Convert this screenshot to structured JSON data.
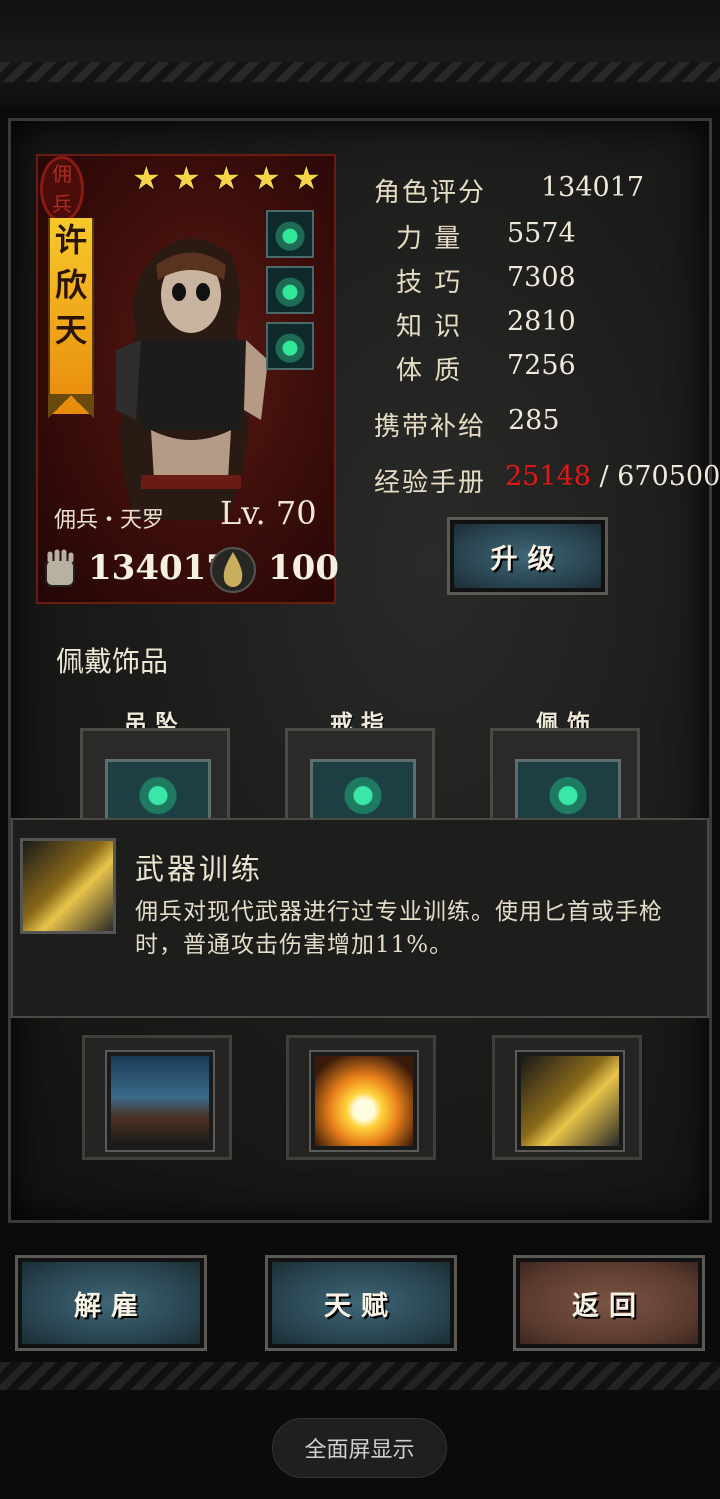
{
  "colors": {
    "accent_gold": "#f7c92a",
    "exp_current": "#e01818",
    "button_blue": "#3f6676",
    "button_brown": "#7a5444"
  },
  "card": {
    "seal_text": "佣兵",
    "stars": 5,
    "name_chars": [
      "许",
      "欣",
      "天"
    ],
    "class_name": "佣兵・天罗",
    "level_text": "Lv. 70",
    "power": "134017",
    "supply": "100",
    "accessory_icons": [
      "pendant-icon",
      "ring-icon",
      "charm-icon"
    ]
  },
  "stats": {
    "rating_label": "角色评分",
    "rating_value": "134017",
    "strength_label": "力 量",
    "strength_value": "5574",
    "skill_label": "技 巧",
    "skill_value": "7308",
    "knowledge_label": "知 识",
    "knowledge_value": "2810",
    "constitution_label": "体 质",
    "constitution_value": "7256",
    "supply_label": "携带补给",
    "supply_value": "285",
    "exp_label": "经验手册",
    "exp_current": "25148",
    "exp_separator": " / ",
    "exp_total": "670500"
  },
  "buttons": {
    "upgrade": "升级",
    "dismiss": "解雇",
    "talent": "天赋",
    "back": "返回"
  },
  "accessories": {
    "title": "佩戴饰品",
    "slots": [
      {
        "label": "吊坠",
        "icon": "pendant-icon"
      },
      {
        "label": "戒指",
        "icon": "ring-icon"
      },
      {
        "label": "佩饰",
        "icon": "charm-icon"
      }
    ]
  },
  "tooltip": {
    "title": "武器训练",
    "description": "佣兵对现代武器进行过专业训练。使用匕首或手枪时，普通攻击伤害增加11%。",
    "icon": "dagger-icon"
  },
  "skills": [
    {
      "icon": "chains-icon"
    },
    {
      "icon": "explosion-icon"
    },
    {
      "icon": "dagger-icon"
    }
  ],
  "system": {
    "fullscreen_label": "全面屏显示"
  }
}
